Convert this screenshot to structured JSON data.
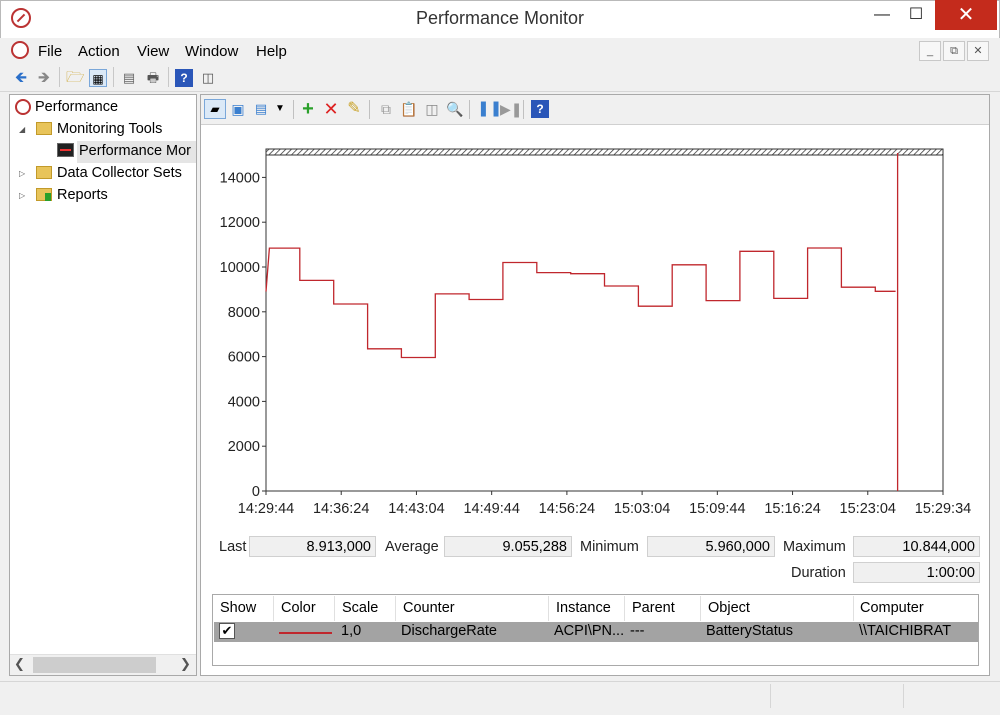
{
  "window": {
    "title": "Performance Monitor"
  },
  "menu": [
    "File",
    "Action",
    "View",
    "Window",
    "Help"
  ],
  "tree": {
    "root": "Performance",
    "items": [
      {
        "label": "Monitoring Tools",
        "expanded": true,
        "icon": "folder-icon"
      },
      {
        "label": "Performance Mor",
        "icon": "performance-monitor-icon"
      },
      {
        "label": "Data Collector Sets",
        "icon": "folder-icon"
      },
      {
        "label": "Reports",
        "icon": "report-folder-icon"
      }
    ]
  },
  "stats": {
    "last_label": "Last",
    "last_value": "8.913,000",
    "average_label": "Average",
    "average_value": "9.055,288",
    "minimum_label": "Minimum",
    "minimum_value": "5.960,000",
    "maximum_label": "Maximum",
    "maximum_value": "10.844,000",
    "duration_label": "Duration",
    "duration_value": "1:00:00"
  },
  "legend": {
    "headers": [
      "Show",
      "Color",
      "Scale",
      "Counter",
      "Instance",
      "Parent",
      "Object",
      "Computer"
    ],
    "row": {
      "show": true,
      "color": "#c0272d",
      "scale": "1,0",
      "counter": "DischargeRate",
      "instance": "ACPI\\PN...",
      "parent": "---",
      "object": "BatteryStatus",
      "computer": "\\\\TAICHIBRAT"
    }
  },
  "chart_data": {
    "type": "line",
    "ylim": [
      0,
      15000
    ],
    "yticks": [
      "0",
      "2000",
      "4000",
      "6000",
      "8000",
      "10000",
      "12000",
      "14000"
    ],
    "xticks": [
      "14:29:44",
      "14:36:24",
      "14:43:04",
      "14:49:44",
      "14:56:24",
      "15:03:04",
      "15:09:44",
      "15:16:24",
      "15:23:04",
      "15:29:34"
    ],
    "series": [
      {
        "color": "#c0272d",
        "points": [
          [
            0.0,
            8900
          ],
          [
            0.005,
            10844
          ],
          [
            0.05,
            10844
          ],
          [
            0.05,
            9400
          ],
          [
            0.1,
            9400
          ],
          [
            0.1,
            8350
          ],
          [
            0.15,
            8350
          ],
          [
            0.15,
            6350
          ],
          [
            0.2,
            6350
          ],
          [
            0.2,
            5960
          ],
          [
            0.25,
            5960
          ],
          [
            0.25,
            8800
          ],
          [
            0.3,
            8800
          ],
          [
            0.3,
            8550
          ],
          [
            0.35,
            8550
          ],
          [
            0.35,
            10200
          ],
          [
            0.4,
            10200
          ],
          [
            0.4,
            9750
          ],
          [
            0.45,
            9750
          ],
          [
            0.45,
            9700
          ],
          [
            0.5,
            9700
          ],
          [
            0.5,
            9150
          ],
          [
            0.55,
            9150
          ],
          [
            0.55,
            8250
          ],
          [
            0.6,
            8250
          ],
          [
            0.6,
            10100
          ],
          [
            0.65,
            10100
          ],
          [
            0.65,
            8500
          ],
          [
            0.7,
            8500
          ],
          [
            0.7,
            10700
          ],
          [
            0.75,
            10700
          ],
          [
            0.75,
            8600
          ],
          [
            0.8,
            8600
          ],
          [
            0.8,
            10850
          ],
          [
            0.85,
            10850
          ],
          [
            0.85,
            9100
          ],
          [
            0.9,
            9100
          ],
          [
            0.9,
            8913
          ],
          [
            0.93,
            8913
          ]
        ]
      }
    ]
  }
}
